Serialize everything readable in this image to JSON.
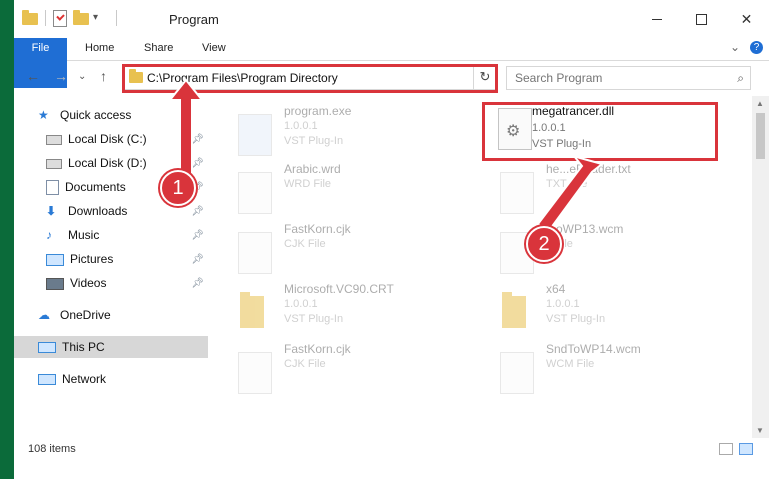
{
  "titlebar": {
    "title": "Program",
    "minimize": "–",
    "maximize": "□",
    "close": "✕"
  },
  "ribbon": {
    "tabs": [
      "File",
      "Home",
      "Share",
      "View"
    ],
    "chevron": "⌄",
    "help": "?"
  },
  "address": {
    "back": "←",
    "forward": "→",
    "recent": "⌄",
    "up": "↑",
    "path": "C:\\Program Files\\Program Directory",
    "dropdown": "⌄",
    "refresh": "↻"
  },
  "search": {
    "placeholder": "Search Program",
    "icon": "search-icon"
  },
  "nav": {
    "items": [
      {
        "label": "Quick access",
        "icon": "star-icon",
        "pinned": false
      },
      {
        "label": "Local Disk (C:)",
        "icon": "drive-icon",
        "pinned": true
      },
      {
        "label": "Local Disk (D:)",
        "icon": "drive-icon",
        "pinned": true
      },
      {
        "label": "Documents",
        "icon": "documents-icon",
        "pinned": true
      },
      {
        "label": "Downloads",
        "icon": "download-icon",
        "pinned": true
      },
      {
        "label": "Music",
        "icon": "music-icon",
        "pinned": true
      },
      {
        "label": "Pictures",
        "icon": "pictures-icon",
        "pinned": true
      },
      {
        "label": "Videos",
        "icon": "videos-icon",
        "pinned": true
      },
      {
        "label": "OneDrive",
        "icon": "cloud-icon",
        "pinned": false
      },
      {
        "label": "This PC",
        "icon": "computer-icon",
        "pinned": false,
        "selected": true
      },
      {
        "label": "Network",
        "icon": "network-icon",
        "pinned": false
      }
    ]
  },
  "files": [
    {
      "name": "program.exe",
      "line1": "1.0.0.1",
      "line2": "VST Plug-In",
      "icon": "exe-icon",
      "faded": true
    },
    {
      "name": "megatrancer.dll",
      "line1": "1.0.0.1",
      "line2": "VST Plug-In",
      "icon": "dll-icon",
      "faded": false
    },
    {
      "name": "Arabic.wrd",
      "line1": "WRD File",
      "line2": "",
      "icon": "blank-file-icon",
      "faded": true
    },
    {
      "name": "he...eReader.txt",
      "line1": "TXT File",
      "line2": "",
      "icon": "blank-file-icon",
      "faded": true
    },
    {
      "name": "FastKorn.cjk",
      "line1": "CJK File",
      "line2": "",
      "icon": "blank-file-icon",
      "faded": true
    },
    {
      "name": "...oWP13.wcm",
      "line1": "...File",
      "line2": "",
      "icon": "blank-file-icon",
      "faded": true
    },
    {
      "name": "Microsoft.VC90.CRT",
      "line1": "1.0.0.1",
      "line2": "VST Plug-In",
      "icon": "folder-icon",
      "faded": true
    },
    {
      "name": "x64",
      "line1": "1.0.0.1",
      "line2": "VST Plug-In",
      "icon": "folder-icon",
      "faded": true
    },
    {
      "name": "FastKorn.cjk",
      "line1": "CJK File",
      "line2": "",
      "icon": "blank-file-icon",
      "faded": true
    },
    {
      "name": "SndToWP14.wcm",
      "line1": "WCM File",
      "line2": "",
      "icon": "blank-file-icon",
      "faded": true
    }
  ],
  "status": {
    "items": "108 items"
  },
  "annotations": {
    "step1": "1",
    "step2": "2",
    "color": "#d9343b"
  },
  "colors": {
    "accent": "#1f6ed4",
    "annotation": "#d9343b"
  }
}
